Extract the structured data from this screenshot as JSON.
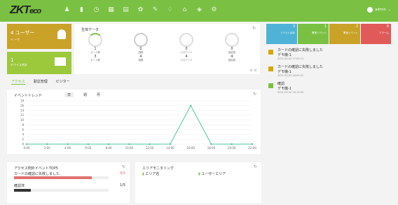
{
  "app": {
    "brand": "ZKT",
    "brand_suffix": "eco",
    "user": "admin"
  },
  "tiles": {
    "users": {
      "value": "4 ユーザー",
      "sub": "ベ ーサ",
      "color": "#c9a227"
    },
    "devices": {
      "value": "1",
      "sub": "デバイス合計",
      "color": "#9cc93c"
    }
  },
  "bio": {
    "title": "生体データ",
    "items": [
      {
        "v1": "1",
        "l1": "カード数",
        "v2": "3",
        "l2": "カード数"
      },
      {
        "v1": "0",
        "l1": "顔数",
        "v2": "4",
        "l2": "顔数"
      },
      {
        "v1": "0",
        "l1": "パスワード",
        "v2": "4",
        "l2": "パスワード"
      },
      {
        "v1": "0",
        "l1": "指紋数",
        "v2": "4",
        "l2": "指紋数"
      }
    ]
  },
  "stats": [
    {
      "n": "3",
      "l": "イベント合計",
      "color": "#4fb3d8"
    },
    {
      "n": "1",
      "l": "異常イベント",
      "color": "#7ac143"
    },
    {
      "n": "2",
      "l": "異常イベント",
      "color": "#c9a227"
    },
    {
      "n": "0",
      "l": "アラーム",
      "color": "#e05a5a"
    }
  ],
  "alerts": [
    {
      "t": "カードの確認に失敗しました",
      "t2": "デモ機-1",
      "tm": "2021-04-02 17:02:11",
      "color": "#d4a800"
    },
    {
      "t": "カードの確認に失敗しました",
      "t2": "デモ機-1",
      "tm": "2021-04-02 16:09:22",
      "color": "#d4a800"
    },
    {
      "t": "確認",
      "t2": "デモ機-1",
      "tm": "2021-04-02 16:15:00",
      "color": "#7ac143"
    }
  ],
  "tabs": [
    "アクセス",
    "勤怠管理",
    "ビジター"
  ],
  "trend": {
    "title": "イベントトレンド",
    "filters": [
      "日",
      "週",
      "月"
    ],
    "chart_data": {
      "type": "line",
      "x": [
        "0:00",
        "2:00",
        "4:00",
        "6:00",
        "8:00",
        "10:00",
        "12:00",
        "14:00",
        "16:00",
        "18:00",
        "20:00",
        "22:00"
      ],
      "values": [
        0,
        0,
        0,
        0,
        0,
        0,
        0,
        0,
        16,
        0,
        0,
        0
      ],
      "ylim": [
        0,
        18
      ],
      "yticks": [
        "18",
        "16",
        "14",
        "12",
        "10",
        "8",
        "6",
        "4",
        "2",
        "0"
      ],
      "color": "#4fc49a"
    }
  },
  "top5": {
    "title": "アクセス例外イベントTOP5",
    "rows": [
      {
        "label": "カードの確認に失敗しました",
        "value": "4/5",
        "pct": 0.82,
        "color": "#e07070"
      },
      {
        "label": "確認済",
        "value": "1/5",
        "pct": 0.18,
        "color": "#333"
      }
    ]
  },
  "area": {
    "title": "エリアモニタリング",
    "col1": "エリア名",
    "col2": "ユーザーエリア"
  }
}
